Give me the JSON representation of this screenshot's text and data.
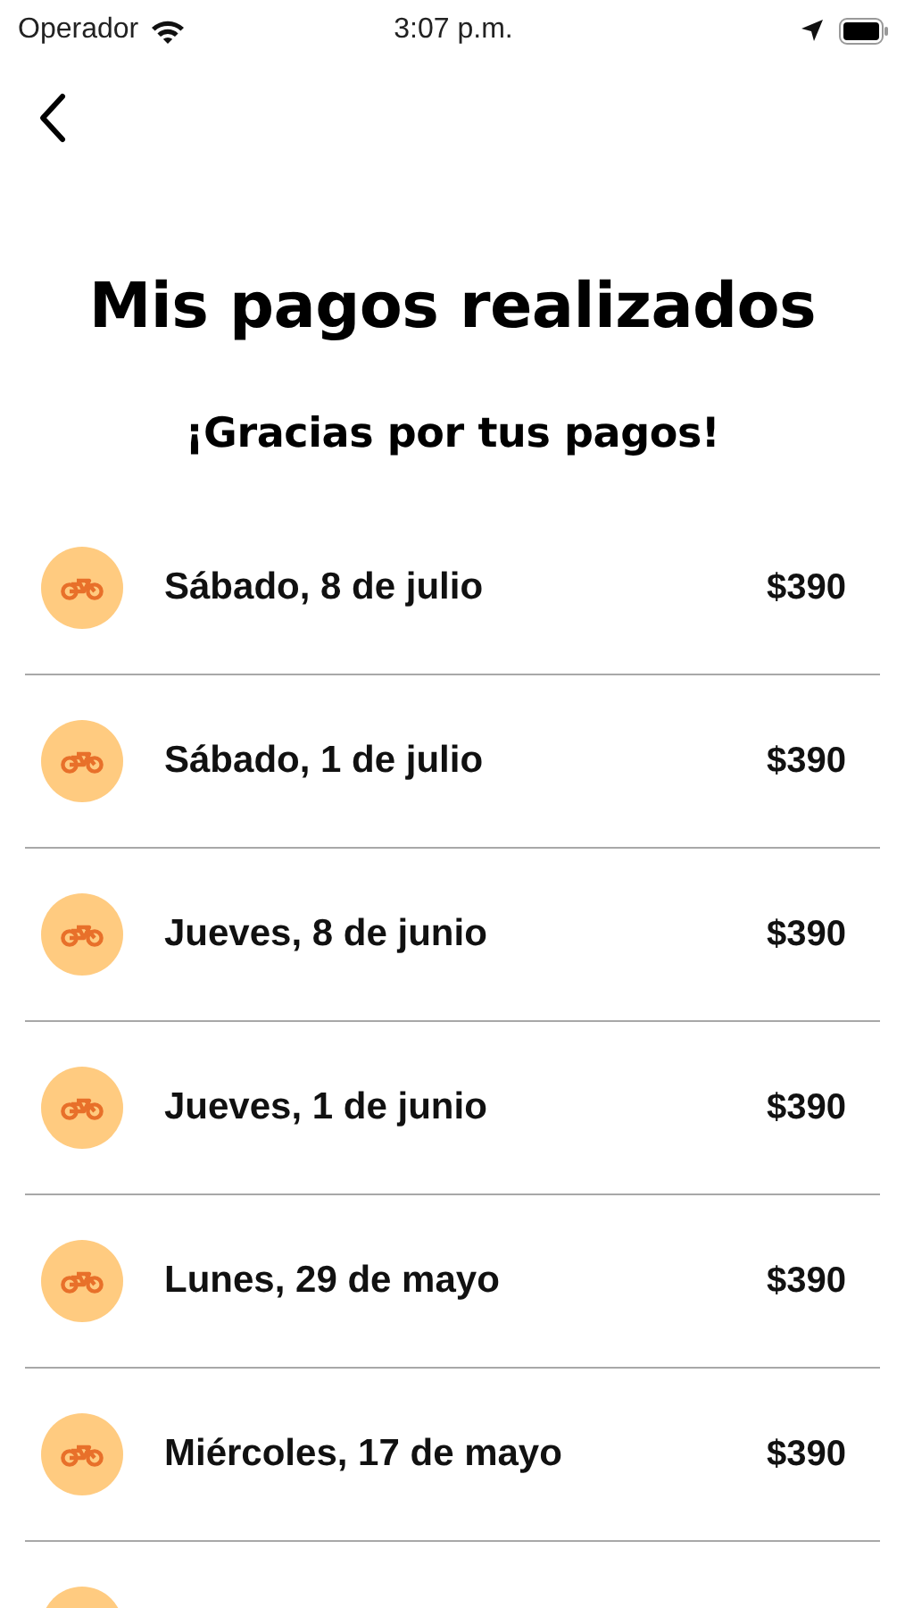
{
  "status_bar": {
    "carrier": "Operador",
    "time": "3:07 p.m."
  },
  "title": "Mis pagos realizados",
  "subtitle": "¡Gracias por tus pagos!",
  "payments": [
    {
      "kind": "payment",
      "date": "Sábado, 8 de julio",
      "amount": "$390"
    },
    {
      "kind": "payment",
      "date": "Sábado, 1 de julio",
      "amount": "$390"
    },
    {
      "kind": "payment",
      "date": "Jueves, 8 de junio",
      "amount": "$390"
    },
    {
      "kind": "payment",
      "date": "Jueves, 1 de junio",
      "amount": "$390"
    },
    {
      "kind": "payment",
      "date": "Lunes, 29 de mayo",
      "amount": "$390"
    },
    {
      "kind": "payment",
      "date": "Miércoles, 17 de mayo",
      "amount": "$390"
    },
    {
      "kind": "cut_off"
    }
  ]
}
